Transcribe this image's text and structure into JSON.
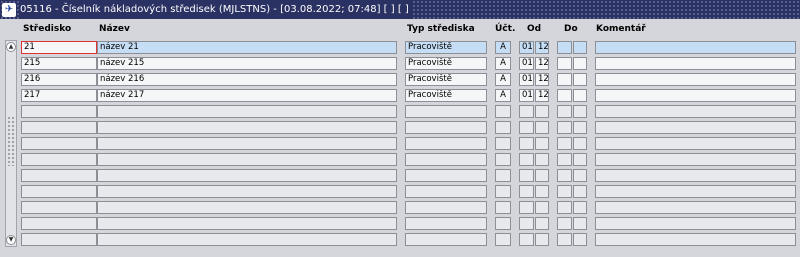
{
  "window": {
    "icon_glyph": "✈",
    "title": "05116 - Číselník nákladových středisek (MJLSTNS) - [03.08.2022; 07:48]  [ ]  [ ]"
  },
  "columns": {
    "stredisko": "Středisko",
    "nazev": "Název",
    "typ": "Typ střediska",
    "uct": "Účt.",
    "od": "Od",
    "do": "Do",
    "komentar": "Komentář"
  },
  "rows": [
    {
      "stredisko": "21",
      "nazev": "název 21",
      "typ": "Pracoviště",
      "uct": "A",
      "od_m": "01",
      "od_y": "12",
      "do_m": "",
      "do_y": "",
      "komentar": ""
    },
    {
      "stredisko": "215",
      "nazev": "název 215",
      "typ": "Pracoviště",
      "uct": "A",
      "od_m": "01",
      "od_y": "12",
      "do_m": "",
      "do_y": "",
      "komentar": ""
    },
    {
      "stredisko": "216",
      "nazev": "název 216",
      "typ": "Pracoviště",
      "uct": "A",
      "od_m": "01",
      "od_y": "12",
      "do_m": "",
      "do_y": "",
      "komentar": ""
    },
    {
      "stredisko": "217",
      "nazev": "název 217",
      "typ": "Pracoviště",
      "uct": "A",
      "od_m": "01",
      "od_y": "12",
      "do_m": "",
      "do_y": "",
      "komentar": ""
    },
    {
      "stredisko": "",
      "nazev": "",
      "typ": "",
      "uct": "",
      "od_m": "",
      "od_y": "",
      "do_m": "",
      "do_y": "",
      "komentar": ""
    },
    {
      "stredisko": "",
      "nazev": "",
      "typ": "",
      "uct": "",
      "od_m": "",
      "od_y": "",
      "do_m": "",
      "do_y": "",
      "komentar": ""
    },
    {
      "stredisko": "",
      "nazev": "",
      "typ": "",
      "uct": "",
      "od_m": "",
      "od_y": "",
      "do_m": "",
      "do_y": "",
      "komentar": ""
    },
    {
      "stredisko": "",
      "nazev": "",
      "typ": "",
      "uct": "",
      "od_m": "",
      "od_y": "",
      "do_m": "",
      "do_y": "",
      "komentar": ""
    },
    {
      "stredisko": "",
      "nazev": "",
      "typ": "",
      "uct": "",
      "od_m": "",
      "od_y": "",
      "do_m": "",
      "do_y": "",
      "komentar": ""
    },
    {
      "stredisko": "",
      "nazev": "",
      "typ": "",
      "uct": "",
      "od_m": "",
      "od_y": "",
      "do_m": "",
      "do_y": "",
      "komentar": ""
    },
    {
      "stredisko": "",
      "nazev": "",
      "typ": "",
      "uct": "",
      "od_m": "",
      "od_y": "",
      "do_m": "",
      "do_y": "",
      "komentar": ""
    },
    {
      "stredisko": "",
      "nazev": "",
      "typ": "",
      "uct": "",
      "od_m": "",
      "od_y": "",
      "do_m": "",
      "do_y": "",
      "komentar": ""
    },
    {
      "stredisko": "",
      "nazev": "",
      "typ": "",
      "uct": "",
      "od_m": "",
      "od_y": "",
      "do_m": "",
      "do_y": "",
      "komentar": ""
    }
  ],
  "selected_row": 0,
  "icons": {
    "scroll_up": "scroll-up-icon",
    "scroll_down": "scroll-down-icon"
  }
}
